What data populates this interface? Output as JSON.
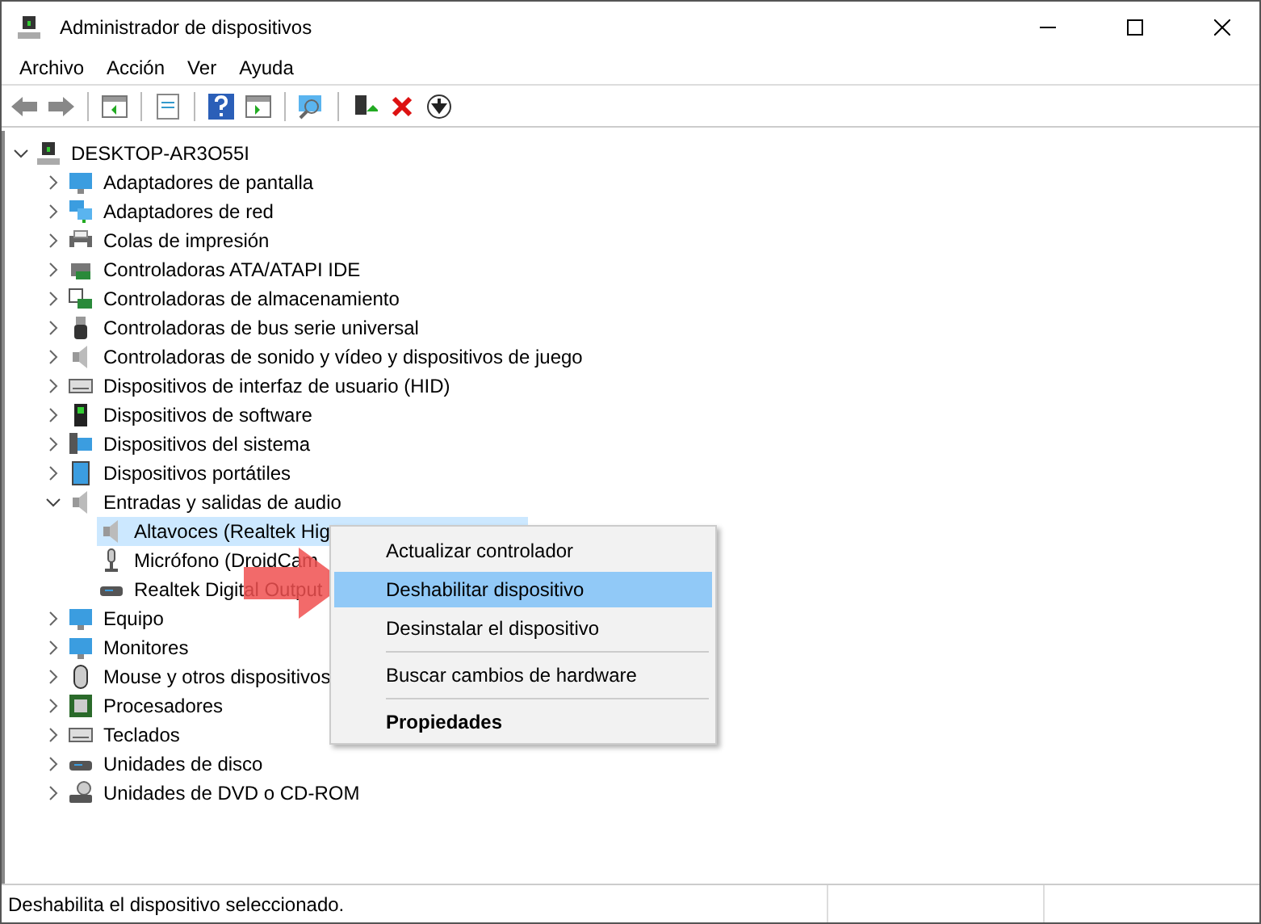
{
  "window": {
    "title": "Administrador de dispositivos"
  },
  "menu_bar": [
    "Archivo",
    "Acción",
    "Ver",
    "Ayuda"
  ],
  "tree": {
    "label": "DESKTOP-AR3O55I",
    "expanded": true,
    "children": [
      {
        "label": "Adaptadores de pantalla",
        "expanded": false
      },
      {
        "label": "Adaptadores de red",
        "expanded": false
      },
      {
        "label": "Colas de impresión",
        "expanded": false
      },
      {
        "label": "Controladoras ATA/ATAPI IDE",
        "expanded": false
      },
      {
        "label": "Controladoras de almacenamiento",
        "expanded": false
      },
      {
        "label": "Controladoras de bus serie universal",
        "expanded": false
      },
      {
        "label": "Controladoras de sonido y vídeo y dispositivos de juego",
        "expanded": false
      },
      {
        "label": "Dispositivos de interfaz de usuario (HID)",
        "expanded": false
      },
      {
        "label": "Dispositivos de software",
        "expanded": false
      },
      {
        "label": "Dispositivos del sistema",
        "expanded": false
      },
      {
        "label": "Dispositivos portátiles",
        "expanded": false
      },
      {
        "label": "Entradas y salidas de audio",
        "expanded": true,
        "children": [
          {
            "label": "Altavoces (Realtek Hig",
            "selected": true
          },
          {
            "label": "Micrófono (DroidCam",
            "selected": false
          },
          {
            "label": "Realtek Digital Output",
            "selected": false
          }
        ]
      },
      {
        "label": "Equipo",
        "expanded": false
      },
      {
        "label": "Monitores",
        "expanded": false
      },
      {
        "label": "Mouse y otros dispositivos",
        "expanded": false
      },
      {
        "label": "Procesadores",
        "expanded": false
      },
      {
        "label": "Teclados",
        "expanded": false
      },
      {
        "label": "Unidades de disco",
        "expanded": false
      },
      {
        "label": "Unidades de DVD o CD-ROM",
        "expanded": false
      }
    ]
  },
  "context_menu": [
    {
      "kind": "item",
      "label": "Actualizar controlador",
      "selected": false
    },
    {
      "kind": "item",
      "label": "Deshabilitar dispositivo",
      "selected": true
    },
    {
      "kind": "item",
      "label": "Desinstalar el dispositivo",
      "selected": false
    },
    {
      "kind": "separator"
    },
    {
      "kind": "item",
      "label": "Buscar cambios de hardware",
      "selected": false
    },
    {
      "kind": "separator"
    },
    {
      "kind": "bold",
      "label": "Propiedades",
      "selected": false
    }
  ],
  "status_bar": {
    "text": "Deshabilita el dispositivo seleccionado."
  }
}
